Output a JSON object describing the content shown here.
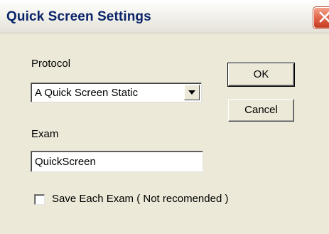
{
  "window": {
    "title": "Quick Screen Settings"
  },
  "icons": {
    "close": "close-icon",
    "dropdown": "chevron-down-icon"
  },
  "protocol": {
    "label": "Protocol",
    "selected": "A Quick Screen Static"
  },
  "exam": {
    "label": "Exam",
    "value": "QuickScreen"
  },
  "buttons": {
    "ok": "OK",
    "cancel": "Cancel"
  },
  "save_each_exam": {
    "label": "Save Each Exam ( Not recomended )",
    "checked": false
  },
  "colors": {
    "title_text": "#0a246a",
    "dialog_face": "#ece9d8",
    "close_button": "#e2664a"
  }
}
